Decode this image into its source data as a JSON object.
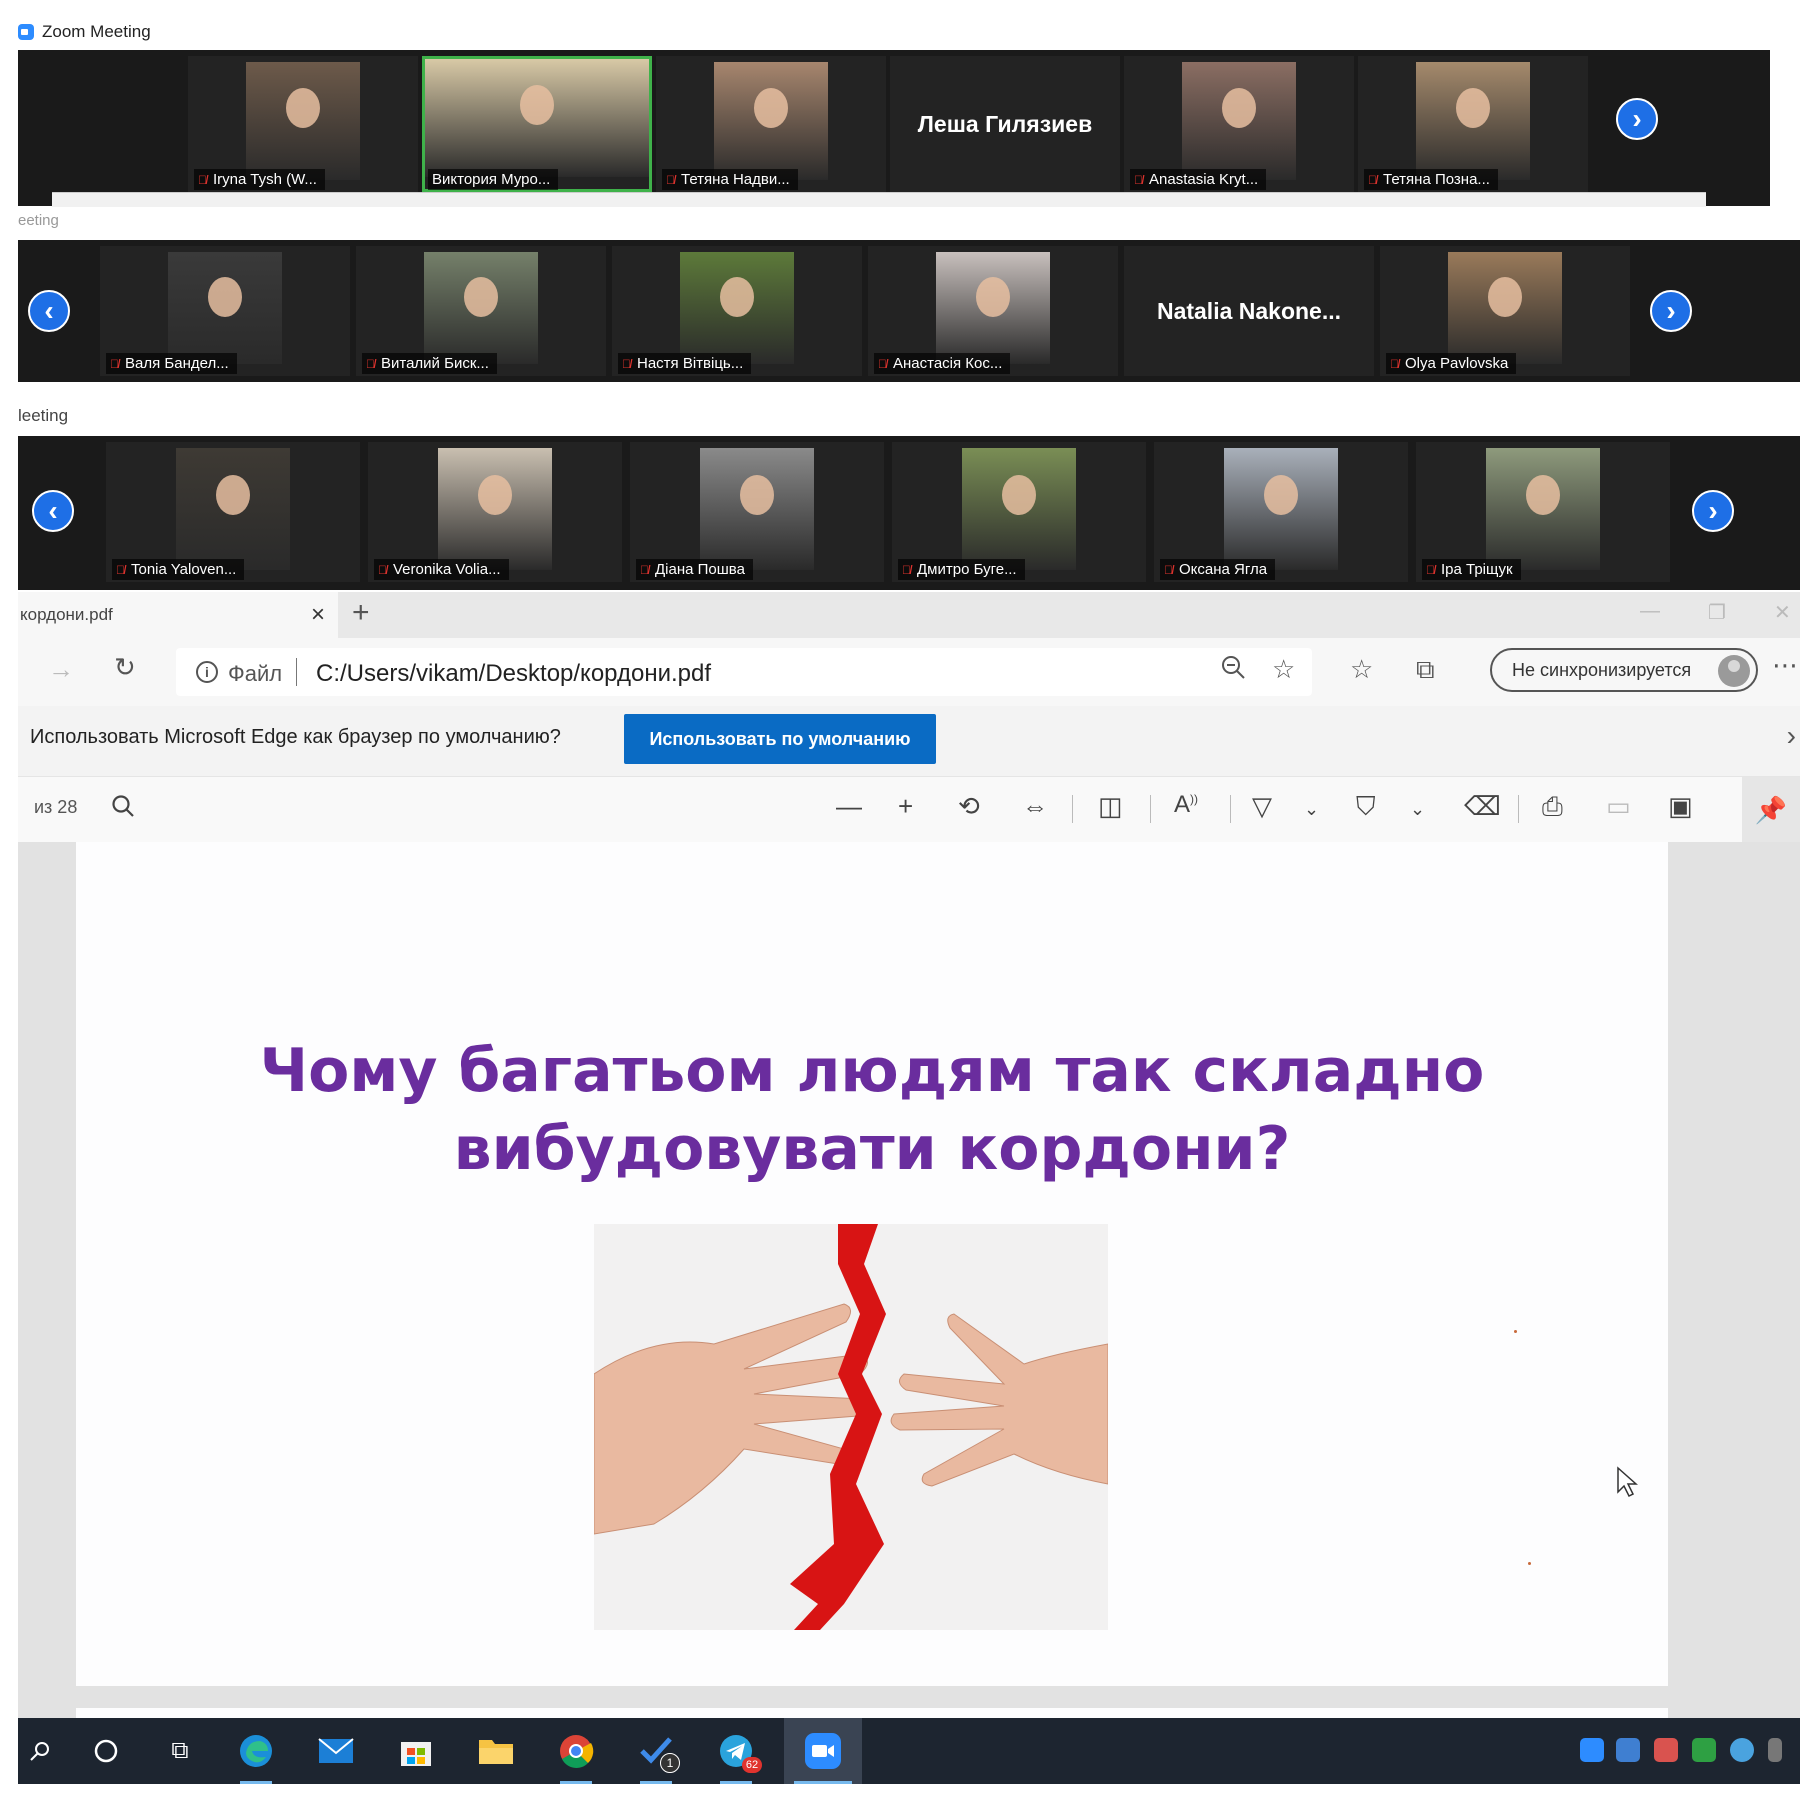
{
  "zoom": {
    "window_title": "Zoom Meeting",
    "fragment_title_2": "eeting",
    "fragment_title_3": "leeting",
    "strip1": [
      {
        "name": "Iryna Tysh (W...",
        "video": true,
        "muted": true
      },
      {
        "name": "Виктория Муро...",
        "video": true,
        "muted": false,
        "active_speaker": true
      },
      {
        "name": "Тетяна Надви...",
        "video": true,
        "muted": true
      },
      {
        "name": "Леша Гилязиев",
        "video": false
      },
      {
        "name": "Anastasia Kryt...",
        "video": true,
        "muted": true
      },
      {
        "name": "Тетяна Позна...",
        "video": true,
        "muted": true
      }
    ],
    "strip2": [
      {
        "name": "Валя Бандел...",
        "video": true,
        "muted": true
      },
      {
        "name": "Виталий Биск...",
        "video": true,
        "muted": true
      },
      {
        "name": "Настя Вітвіць...",
        "video": true,
        "muted": true
      },
      {
        "name": "Анастасія Кос...",
        "video": true,
        "muted": true
      },
      {
        "name": "Natalia  Nakone...",
        "video": false
      },
      {
        "name": "Olya Pavlovska",
        "video": true,
        "muted": true
      }
    ],
    "strip3": [
      {
        "name": "Tonia Yaloven...",
        "video": true,
        "muted": true
      },
      {
        "name": "Veronika Volia...",
        "video": true,
        "muted": true
      },
      {
        "name": "Діана Пошва",
        "video": true,
        "muted": true
      },
      {
        "name": "Дмитро Буге...",
        "video": true,
        "muted": true
      },
      {
        "name": "Оксана Ягла",
        "video": true,
        "muted": true
      },
      {
        "name": "Іра Тріщук",
        "video": true,
        "muted": true
      }
    ]
  },
  "browser": {
    "tab_title": "кордони.pdf",
    "file_label": "Файл",
    "url": "C:/Users/vikam/Desktop/кордони.pdf",
    "sync_label": "Не синхронизируется",
    "infobar_text": "Использовать Microsoft Edge как браузер по умолчанию?",
    "infobar_button": "Использовать по умолчанию",
    "page_count": "из 28"
  },
  "slide": {
    "title_line1": "Чому багатьом людям так складно",
    "title_line2": "вибудовувати кордони?"
  },
  "taskbar": {
    "todo_badge": "1",
    "telegram_badge": "62"
  },
  "colors": {
    "zoom_blue": "#1e6fe6",
    "slide_purple": "#6a2d9e",
    "edge_button": "#0a6bc4",
    "muted_red": "#e0332e",
    "active_green": "#3fb24a"
  }
}
